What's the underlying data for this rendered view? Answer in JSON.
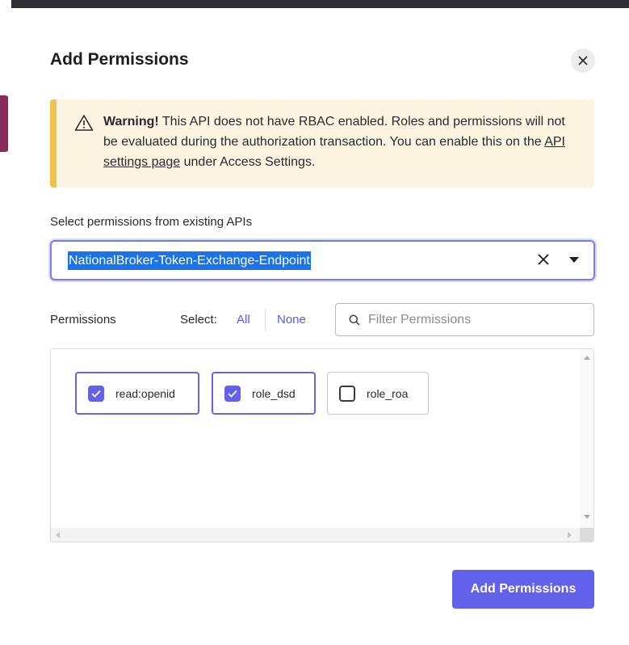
{
  "modal": {
    "title": "Add Permissions",
    "close_icon": "close-icon"
  },
  "warning": {
    "icon": "warning-triangle-icon",
    "strong": "Warning!",
    "text_before_link": " This API does not have RBAC enabled. Roles and permissions will not be evaluated during the authorization transaction. You can enable this on the ",
    "link": "API settings page",
    "text_after_link": " under Access Settings."
  },
  "api_select": {
    "label": "Select permissions from existing APIs",
    "value": "NationalBroker-Token-Exchange-Endpoint"
  },
  "permissions": {
    "label": "Permissions",
    "select_label": "Select:",
    "all_label": "All",
    "none_label": "None",
    "filter_placeholder": "Filter Permissions",
    "items": [
      {
        "label": "read:openid",
        "checked": true
      },
      {
        "label": "role_dsd",
        "checked": true
      },
      {
        "label": "role_roa",
        "checked": false
      }
    ]
  },
  "footer": {
    "submit_label": "Add Permissions"
  },
  "colors": {
    "accent": "#6161ec",
    "warning_bar": "#eec34a",
    "warning_bg": "#fdf3e1",
    "selection": "#1a73e8"
  }
}
